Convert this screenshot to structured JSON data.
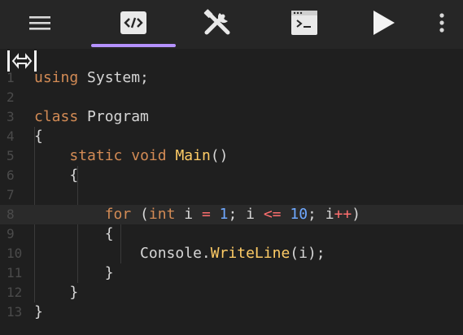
{
  "toolbar": {
    "icons": [
      "menu-icon",
      "code-icon",
      "tools-icon",
      "terminal-icon",
      "play-icon",
      "more-vertical-icon"
    ]
  },
  "editor": {
    "cursor_handle_icon": "horizontal-resize-icon",
    "line_numbers": [
      "1",
      "2",
      "3",
      "4",
      "5",
      "6",
      "7",
      "8",
      "9",
      "10",
      "11",
      "12",
      "13"
    ],
    "lines": [
      {
        "tokens": [
          {
            "t": "using",
            "c": "kw"
          },
          {
            "t": " System;",
            "c": "plain"
          }
        ]
      },
      {
        "tokens": []
      },
      {
        "tokens": [
          {
            "t": "class",
            "c": "kw"
          },
          {
            "t": " Program",
            "c": "plain"
          }
        ]
      },
      {
        "tokens": [
          {
            "t": "{",
            "c": "plain"
          }
        ]
      },
      {
        "tokens": [
          {
            "t": "    ",
            "c": "plain"
          },
          {
            "t": "static",
            "c": "kw"
          },
          {
            "t": " ",
            "c": "plain"
          },
          {
            "t": "void",
            "c": "kw"
          },
          {
            "t": " ",
            "c": "plain"
          },
          {
            "t": "Main",
            "c": "fn"
          },
          {
            "t": "()",
            "c": "plain"
          }
        ]
      },
      {
        "tokens": [
          {
            "t": "    {",
            "c": "plain"
          }
        ]
      },
      {
        "tokens": []
      },
      {
        "tokens": [
          {
            "t": "        ",
            "c": "plain"
          },
          {
            "t": "for",
            "c": "kw"
          },
          {
            "t": " (",
            "c": "plain"
          },
          {
            "t": "int",
            "c": "kw"
          },
          {
            "t": " i ",
            "c": "plain"
          },
          {
            "t": "=",
            "c": "op"
          },
          {
            "t": " ",
            "c": "plain"
          },
          {
            "t": "1",
            "c": "num"
          },
          {
            "t": "; i ",
            "c": "plain"
          },
          {
            "t": "<=",
            "c": "op"
          },
          {
            "t": " ",
            "c": "plain"
          },
          {
            "t": "10",
            "c": "num"
          },
          {
            "t": "; i",
            "c": "plain"
          },
          {
            "t": "++",
            "c": "op"
          },
          {
            "t": ")",
            "c": "plain"
          }
        ]
      },
      {
        "tokens": [
          {
            "t": "        {",
            "c": "plain"
          }
        ]
      },
      {
        "tokens": [
          {
            "t": "            Console.",
            "c": "plain"
          },
          {
            "t": "WriteLine",
            "c": "fn"
          },
          {
            "t": "(i);",
            "c": "plain"
          }
        ]
      },
      {
        "tokens": [
          {
            "t": "        }",
            "c": "plain"
          }
        ]
      },
      {
        "tokens": [
          {
            "t": "    }",
            "c": "plain"
          }
        ]
      },
      {
        "tokens": [
          {
            "t": "}",
            "c": "plain"
          }
        ]
      }
    ],
    "active_line": 8
  },
  "colors": {
    "background": "#1f1f1f",
    "toolbar": "#262626",
    "accent": "#b592ff",
    "keyword": "#d38b55",
    "function": "#ffcc66",
    "number": "#6fa8ff",
    "operator": "#ff6f6f",
    "text": "#d7d7d7",
    "line_number": "#4b4b4b"
  }
}
